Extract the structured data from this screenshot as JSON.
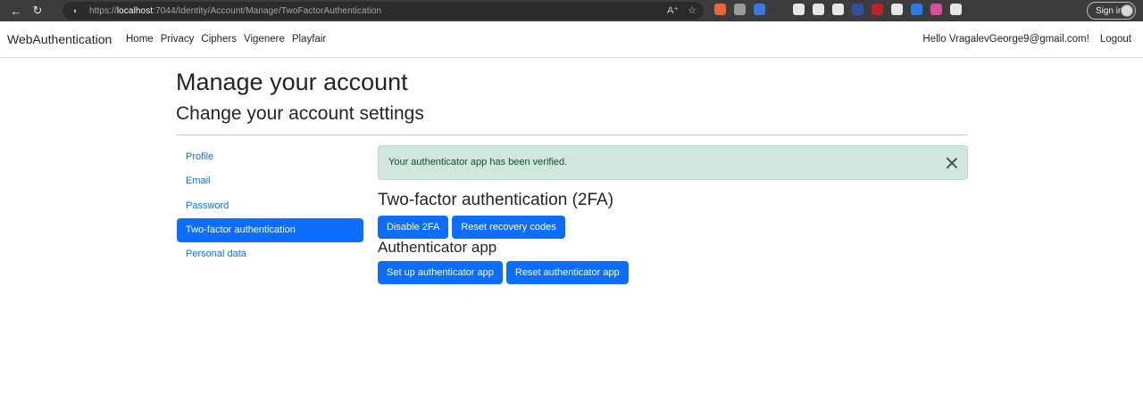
{
  "browser": {
    "url_prefix": "https://",
    "url_host": "localhost",
    "url_rest": ":7044/Identity/Account/Manage/TwoFactorAuthentication",
    "sign_in_label": "Sign in",
    "extension_colors": [
      "#e8663d",
      "#9a9a9a",
      "#3b78d8",
      "#3c3c3c",
      "#e6e6e6",
      "#e6e6e6",
      "#e6e6e6",
      "#2f4fa0",
      "#c0202a",
      "#e6e6e6",
      "#2d7be5",
      "#d94d9b",
      "#e6e6e6"
    ]
  },
  "navbar": {
    "brand": "WebAuthentication",
    "links": [
      "Home",
      "Privacy",
      "Ciphers",
      "Vigenere",
      "Playfair"
    ],
    "greeting": "Hello VragalevGeorge9@gmail.com!",
    "logout": "Logout"
  },
  "page": {
    "title": "Manage your account",
    "subtitle": "Change your account settings"
  },
  "sidebar": {
    "items": [
      {
        "label": "Profile",
        "active": false
      },
      {
        "label": "Email",
        "active": false
      },
      {
        "label": "Password",
        "active": false
      },
      {
        "label": "Two-factor authentication",
        "active": true
      },
      {
        "label": "Personal data",
        "active": false
      }
    ]
  },
  "alert": {
    "message": "Your authenticator app has been verified."
  },
  "two_factor": {
    "heading": "Two-factor authentication (2FA)",
    "disable_label": "Disable 2FA",
    "reset_codes_label": "Reset recovery codes"
  },
  "authenticator": {
    "heading": "Authenticator app",
    "setup_label": "Set up authenticator app",
    "reset_label": "Reset authenticator app"
  },
  "colors": {
    "primary": "#0d6efd",
    "alert_bg": "#d1e7dd",
    "alert_text": "#0f5132"
  }
}
